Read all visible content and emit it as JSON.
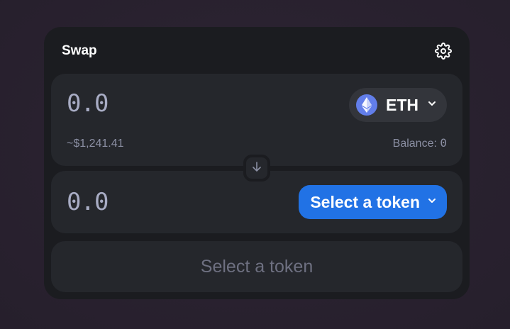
{
  "swap": {
    "title": "Swap",
    "settings_icon": "gear-icon"
  },
  "input_panel": {
    "amount_placeholder": "0.0",
    "token": {
      "symbol": "ETH",
      "icon": "eth-icon",
      "icon_color": "#627eea"
    },
    "usd_value": "~$1,241.41",
    "balance_label": "Balance:",
    "balance_value": "0"
  },
  "switch_icon": "arrow-down-icon",
  "output_panel": {
    "amount_placeholder": "0.0",
    "select_label": "Select a token",
    "select_color": "#2172e5"
  },
  "action_button": {
    "label": "Select a token"
  }
}
